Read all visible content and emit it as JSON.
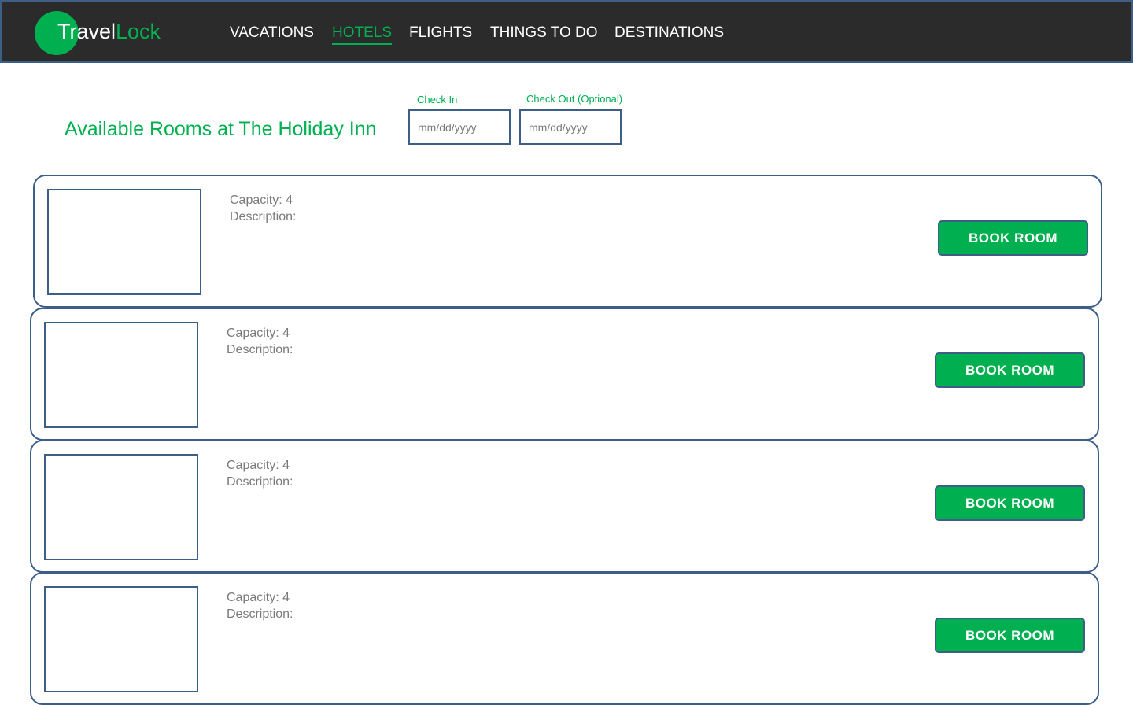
{
  "brand": {
    "part1": "Travel",
    "part2": "Lock"
  },
  "nav": {
    "items": [
      {
        "label": "VACATIONS"
      },
      {
        "label": "HOTELS"
      },
      {
        "label": "FLIGHTS"
      },
      {
        "label": "THINGS TO DO"
      },
      {
        "label": "DESTINATIONS"
      }
    ],
    "active": "HOTELS"
  },
  "page": {
    "title": "Available Rooms at The Holiday Inn"
  },
  "dates": {
    "check_in_label": "Check In",
    "check_in_placeholder": "mm/dd/yyyy",
    "check_out_label": "Check Out (Optional)",
    "check_out_placeholder": "mm/dd/yyyy"
  },
  "rooms": [
    {
      "capacity": "Capacity: 4",
      "description": "Description:",
      "button": "BOOK ROOM"
    },
    {
      "capacity": "Capacity: 4",
      "description": "Description:",
      "button": "BOOK ROOM"
    },
    {
      "capacity": "Capacity: 4",
      "description": "Description:",
      "button": "BOOK ROOM"
    },
    {
      "capacity": "Capacity: 4",
      "description": "Description:",
      "button": "BOOK ROOM"
    }
  ],
  "colors": {
    "accent": "#00b050",
    "header_bg": "#2b2b2b",
    "border": "#3d5e86",
    "muted_text": "#7a7a7a"
  }
}
